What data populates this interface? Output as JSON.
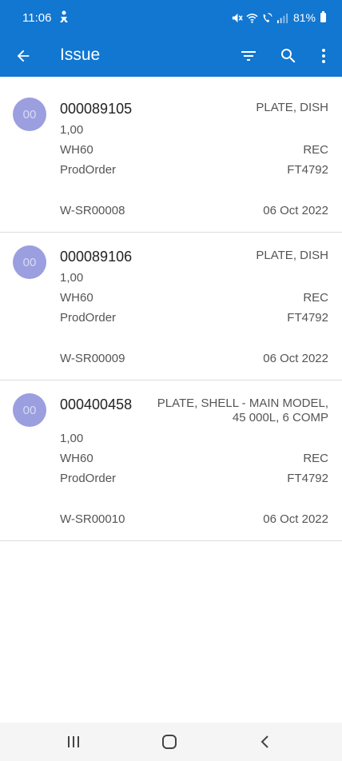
{
  "status_bar": {
    "time": "11:06",
    "battery": "81%"
  },
  "app_bar": {
    "title": "Issue"
  },
  "items": [
    {
      "avatar": "00",
      "number": "000089105",
      "description": "PLATE, DISH",
      "quantity": "1,00",
      "location": "WH60",
      "location_code": "REC",
      "source_type": "ProdOrder",
      "source_no": "FT4792",
      "reference": "W-SR00008",
      "date": "06 Oct 2022"
    },
    {
      "avatar": "00",
      "number": "000089106",
      "description": "PLATE, DISH",
      "quantity": "1,00",
      "location": "WH60",
      "location_code": "REC",
      "source_type": "ProdOrder",
      "source_no": "FT4792",
      "reference": "W-SR00009",
      "date": "06 Oct 2022"
    },
    {
      "avatar": "00",
      "number": "000400458",
      "description_line1": "PLATE, SHELL - MAIN MODEL,",
      "description_line2": "45 000L, 6 COMP",
      "quantity": "1,00",
      "location": "WH60",
      "location_code": "REC",
      "source_type": "ProdOrder",
      "source_no": "FT4792",
      "reference": "W-SR00010",
      "date": "06 Oct 2022"
    }
  ],
  "icons": {
    "back": "arrow-back-icon",
    "filter": "filter-icon",
    "search": "search-icon",
    "more": "more-vert-icon",
    "nav_recent": "recent-apps-icon",
    "nav_home": "home-icon",
    "nav_back": "nav-back-icon"
  },
  "colors": {
    "primary": "#1177d1",
    "avatar": "#9b9fdf"
  }
}
